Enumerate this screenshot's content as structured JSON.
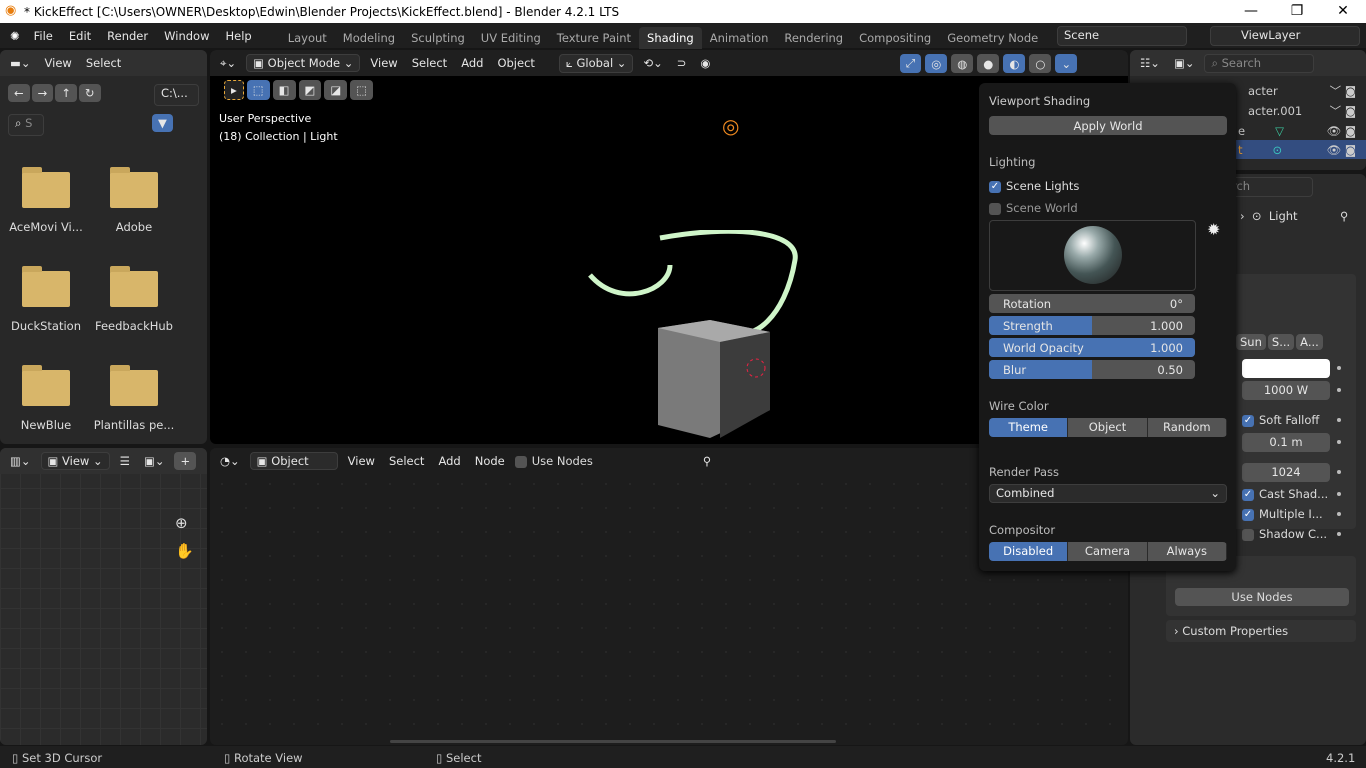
{
  "window": {
    "title": "* KickEffect [C:\\Users\\OWNER\\Desktop\\Edwin\\Blender Projects\\KickEffect.blend] - Blender 4.2.1 LTS",
    "minimize": "—",
    "maximize": "❐",
    "close": "✕"
  },
  "menu": [
    "File",
    "Edit",
    "Render",
    "Window",
    "Help"
  ],
  "workspaces": [
    "Layout",
    "Modeling",
    "Sculpting",
    "UV Editing",
    "Texture Paint",
    "Shading",
    "Animation",
    "Rendering",
    "Compositing",
    "Geometry Node"
  ],
  "active_workspace": "Shading",
  "scene": "Scene",
  "view_layer": "ViewLayer",
  "file_browser": {
    "view": "View",
    "select": "Select",
    "path": "C:\\...",
    "search_placeholder": "S",
    "folders": [
      "AceMovi Vi...",
      "Adobe",
      "DuckStation",
      "FeedbackHub",
      "NewBlue",
      "Plantillas pe..."
    ]
  },
  "viewport": {
    "mode": "Object Mode",
    "menus": [
      "View",
      "Select",
      "Add",
      "Object"
    ],
    "orientation": "Global",
    "info_line1": "User Perspective",
    "info_line2": "(18) Collection | Light"
  },
  "popover": {
    "title": "Viewport Shading",
    "apply_world": "Apply World",
    "lighting": "Lighting",
    "scene_lights": "Scene Lights",
    "scene_world": "Scene World",
    "rotation_label": "Rotation",
    "rotation": "0°",
    "strength_label": "Strength",
    "strength": "1.000",
    "world_opacity_label": "World Opacity",
    "world_opacity": "1.000",
    "blur_label": "Blur",
    "blur": "0.50",
    "wire_color": "Wire Color",
    "wire_options": [
      "Theme",
      "Object",
      "Random"
    ],
    "render_pass": "Render Pass",
    "render_pass_value": "Combined",
    "compositor": "Compositor",
    "compositor_options": [
      "Disabled",
      "Camera",
      "Always"
    ],
    "accent": "#4772b3"
  },
  "image_editor": {
    "view": "View"
  },
  "node_editor": {
    "object": "Object",
    "menus": [
      "View",
      "Select",
      "Add",
      "Node"
    ],
    "use_nodes": "Use Nodes"
  },
  "outliner": {
    "search_placeholder": "Search",
    "items": [
      "acter",
      "acter.001",
      "e",
      "t"
    ]
  },
  "properties": {
    "search_placeholder": "rch",
    "breadcrumb": "Light",
    "light_types": [
      "Sun",
      "S...",
      "A..."
    ],
    "power": "1000 W",
    "soft_falloff": "Soft Falloff",
    "radius": "0.1 m",
    "resolution": "1024",
    "cast_shadow": "Cast Shad...",
    "multiple_importance": "Multiple I...",
    "shadow_caustics": "Shadow C...",
    "use_nodes": "Use Nodes",
    "custom_properties": "Custom Properties"
  },
  "status": {
    "left": "Set 3D Cursor",
    "middle": "Rotate View",
    "right": "Select",
    "version": "4.2.1"
  }
}
